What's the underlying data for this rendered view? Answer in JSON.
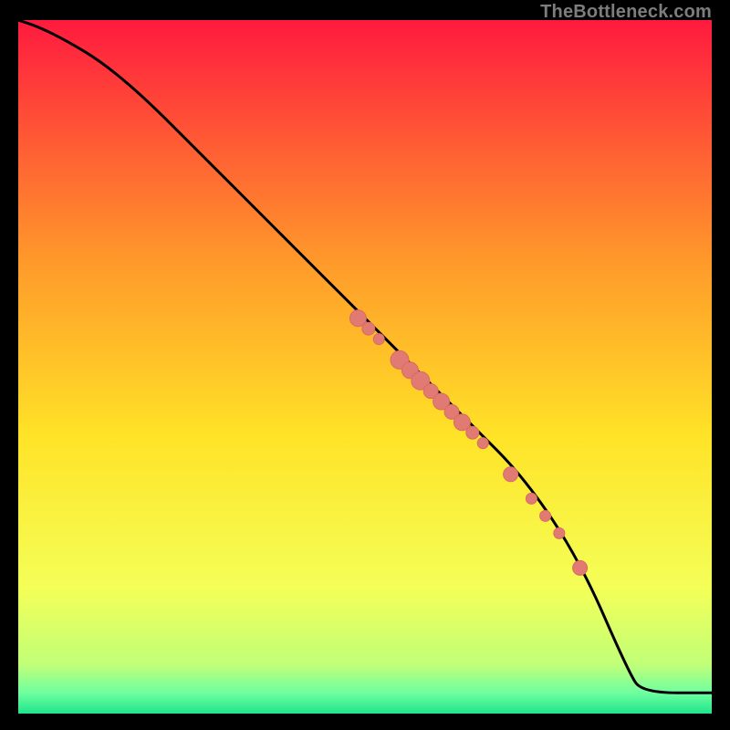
{
  "watermark": "TheBottleneck.com",
  "colors": {
    "gradient_top": "#ff1a3f",
    "gradient_mid1": "#ff7b2d",
    "gradient_mid2": "#ffd922",
    "gradient_mid3": "#f7ff4d",
    "gradient_mid4": "#c8ff6b",
    "gradient_bottom": "#1FE58C",
    "curve": "#000000",
    "points_fill": "#e27a74",
    "points_stroke": "#d96a63",
    "background": "#000000"
  },
  "chart_data": {
    "type": "line",
    "title": "",
    "xlabel": "",
    "ylabel": "",
    "xlim": [
      0,
      100
    ],
    "ylim": [
      0,
      100
    ],
    "grid": false,
    "series": [
      {
        "name": "bottleneck-curve",
        "x": [
          0,
          3,
          7,
          12,
          18,
          25,
          33,
          41,
          49,
          57,
          65,
          73,
          81,
          88,
          90,
          100
        ],
        "y": [
          100,
          99,
          97,
          94,
          89,
          82,
          74,
          66,
          58,
          50,
          42,
          34,
          22,
          6,
          3,
          3
        ]
      }
    ],
    "points": [
      {
        "x": 49,
        "y": 57,
        "r": 9
      },
      {
        "x": 50.5,
        "y": 55.5,
        "r": 7
      },
      {
        "x": 52,
        "y": 54,
        "r": 6
      },
      {
        "x": 55,
        "y": 51,
        "r": 10
      },
      {
        "x": 56.5,
        "y": 49.5,
        "r": 9
      },
      {
        "x": 58,
        "y": 48,
        "r": 10
      },
      {
        "x": 59.5,
        "y": 46.5,
        "r": 8
      },
      {
        "x": 61,
        "y": 45,
        "r": 9
      },
      {
        "x": 62.5,
        "y": 43.5,
        "r": 8
      },
      {
        "x": 64,
        "y": 42,
        "r": 9
      },
      {
        "x": 65.5,
        "y": 40.5,
        "r": 7
      },
      {
        "x": 67,
        "y": 39,
        "r": 6
      },
      {
        "x": 71,
        "y": 34.5,
        "r": 8
      },
      {
        "x": 74,
        "y": 31,
        "r": 6
      },
      {
        "x": 76,
        "y": 28.5,
        "r": 6
      },
      {
        "x": 78,
        "y": 26,
        "r": 6
      },
      {
        "x": 81,
        "y": 21,
        "r": 8
      }
    ]
  }
}
